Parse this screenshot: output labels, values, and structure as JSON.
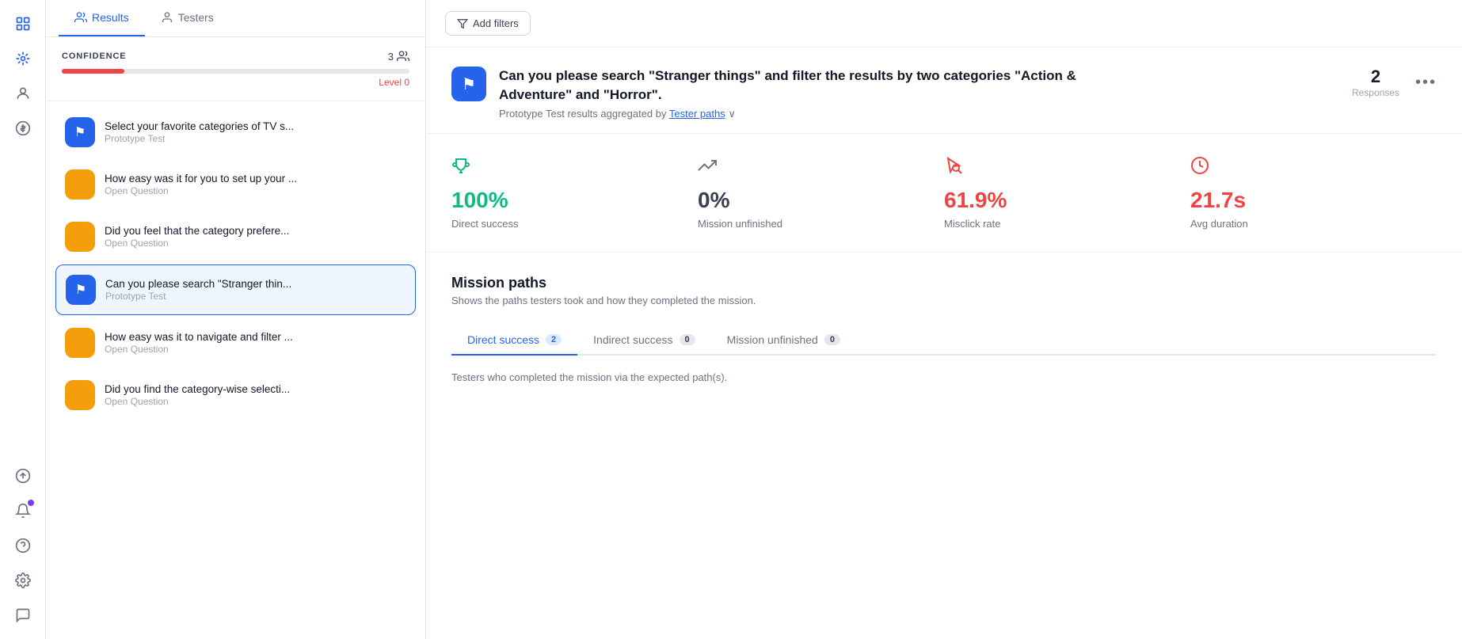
{
  "nav": {
    "icons": [
      {
        "name": "home-icon",
        "symbol": "⊞",
        "active": false
      },
      {
        "name": "grid-icon",
        "symbol": "⊡",
        "active": true
      },
      {
        "name": "user-circle-icon",
        "symbol": "◎",
        "active": false
      },
      {
        "name": "billing-icon",
        "symbol": "◫",
        "active": false
      },
      {
        "name": "upload-icon",
        "symbol": "⬆",
        "active": false
      },
      {
        "name": "bell-icon",
        "symbol": "🔔",
        "active": false,
        "badge": true
      },
      {
        "name": "help-icon",
        "symbol": "?",
        "active": false
      },
      {
        "name": "settings-icon",
        "symbol": "⚙",
        "active": false
      },
      {
        "name": "feedback-icon",
        "symbol": "☁",
        "active": false
      }
    ]
  },
  "sidebar": {
    "tabs": [
      {
        "label": "Results",
        "active": true
      },
      {
        "label": "Testers",
        "active": false
      }
    ],
    "confidence": {
      "label": "CONFIDENCE",
      "count": "3",
      "progress": 18,
      "level": "Level 0"
    },
    "tasks": [
      {
        "id": "task-1",
        "icon_type": "blue",
        "icon_symbol": "⚑",
        "title": "Select your favorite categories of TV s...",
        "subtitle": "Prototype Test",
        "active": false
      },
      {
        "id": "task-2",
        "icon_type": "orange",
        "icon_symbol": "≡",
        "title": "How easy was it for you to set up your ...",
        "subtitle": "Open Question",
        "active": false
      },
      {
        "id": "task-3",
        "icon_type": "orange",
        "icon_symbol": "≡",
        "title": "Did you feel that the category prefere...",
        "subtitle": "Open Question",
        "active": false
      },
      {
        "id": "task-4",
        "icon_type": "blue",
        "icon_symbol": "⚑",
        "title": "Can you please search \"Stranger thin...",
        "subtitle": "Prototype Test",
        "active": true
      },
      {
        "id": "task-5",
        "icon_type": "orange",
        "icon_symbol": "≡",
        "title": "How easy was it to navigate and filter ...",
        "subtitle": "Open Question",
        "active": false
      },
      {
        "id": "task-6",
        "icon_type": "orange",
        "icon_symbol": "≡",
        "title": "Did you find the category-wise selecti...",
        "subtitle": "Open Question",
        "active": false
      }
    ]
  },
  "main": {
    "add_filters_label": "Add filters",
    "task": {
      "icon_symbol": "⚑",
      "title": "Can you please search \"Stranger things\" and filter the results by two categories \"Action & Adventure\" and \"Horror\".",
      "subtitle_prefix": "Prototype Test results aggregated by",
      "subtitle_link": "Tester paths",
      "responses_count": "2",
      "responses_label": "Responses",
      "more_icon": "•••"
    },
    "stats": [
      {
        "icon": "🏆",
        "icon_class": "green",
        "value": "100%",
        "value_class": "green",
        "label": "Direct success"
      },
      {
        "icon": "↗",
        "icon_class": "gray",
        "value": "0%",
        "value_class": "gray",
        "label": "Mission unfinished"
      },
      {
        "icon": "⊕",
        "icon_class": "red",
        "value": "61.9%",
        "value_class": "red",
        "label": "Misclick rate"
      },
      {
        "icon": "⏱",
        "icon_class": "red",
        "value": "21.7s",
        "value_class": "red",
        "label": "Avg duration"
      }
    ],
    "mission_paths": {
      "title": "Mission paths",
      "subtitle": "Shows the paths testers took and how they completed the mission.",
      "tabs": [
        {
          "label": "Direct success",
          "count": "2",
          "active": true
        },
        {
          "label": "Indirect success",
          "count": "0",
          "active": false
        },
        {
          "label": "Mission unfinished",
          "count": "0",
          "active": false
        }
      ],
      "testers_note": "Testers who completed the mission via the expected path(s)."
    }
  }
}
